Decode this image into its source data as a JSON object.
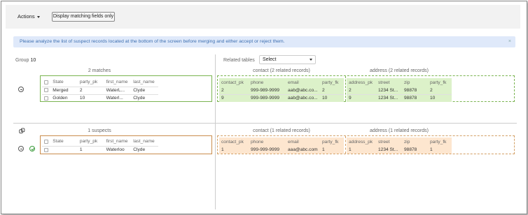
{
  "toolbar": {
    "actions_label": "Actions",
    "display_matching_label": "Display matching fields only"
  },
  "info_message": "Please analyze the list of suspect records located at the bottom of the screen before merging and either accept or reject them.",
  "info_close": "×",
  "group": {
    "label": "Group",
    "value": "10"
  },
  "related_tables": {
    "label": "Related tables",
    "selected": "Select"
  },
  "matches": {
    "title": "2 matches",
    "columns": [
      "State",
      "party_pk",
      "first_name",
      "last_name"
    ],
    "rows": [
      {
        "state": "Merged",
        "party_pk": "2",
        "first_name": "WaterL...",
        "last_name": "Clyde"
      },
      {
        "state": "Golden",
        "party_pk": "10",
        "first_name": "Waterl...",
        "last_name": "Clyde"
      }
    ],
    "contact": {
      "title": "contact (2 related records)",
      "columns": [
        "contact_pk",
        "phone",
        "email",
        "party_fk"
      ],
      "rows": [
        [
          "2",
          "999-989-9999",
          "aab@abc.co...",
          "2"
        ],
        [
          "9",
          "999-989-9999",
          "aab@abc.co...",
          "10"
        ]
      ]
    },
    "address": {
      "title": "address (2 related records)",
      "columns": [
        "address_pk",
        "street",
        "zip",
        "party_fk"
      ],
      "rows": [
        [
          "2",
          "1234 St...",
          "98878",
          "2"
        ],
        [
          "9",
          "1234 St...",
          "98878",
          "10"
        ]
      ]
    }
  },
  "suspects": {
    "title": "1 suspects",
    "columns": [
      "State",
      "party_pk",
      "first_name",
      "last_name"
    ],
    "rows": [
      {
        "state": "",
        "party_pk": "1",
        "first_name": "Waterloo",
        "last_name": "Clyde"
      }
    ],
    "contact": {
      "title": "contact (1 related records)",
      "columns": [
        "contact_pk",
        "phone",
        "email",
        "party_fk"
      ],
      "rows": [
        [
          "1",
          "999-999-9999",
          "aaa@abc.com",
          "1"
        ]
      ]
    },
    "address": {
      "title": "address (1 related records)",
      "columns": [
        "address_pk",
        "street",
        "zip",
        "party_fk"
      ],
      "rows": [
        [
          "1",
          "1234 St...",
          "98878",
          "1"
        ]
      ]
    }
  },
  "icons": {
    "collapse": "minus-circle-icon",
    "accept": "check-circle-icon",
    "link": "link-icon"
  },
  "colors": {
    "match_green": "#7ab450",
    "match_fill": "#dcf1c9",
    "suspect_orange": "#c98c4c",
    "suspect_fill": "#fde6cf",
    "info_bg": "#dfe9fa",
    "info_text": "#3d6fb0"
  }
}
